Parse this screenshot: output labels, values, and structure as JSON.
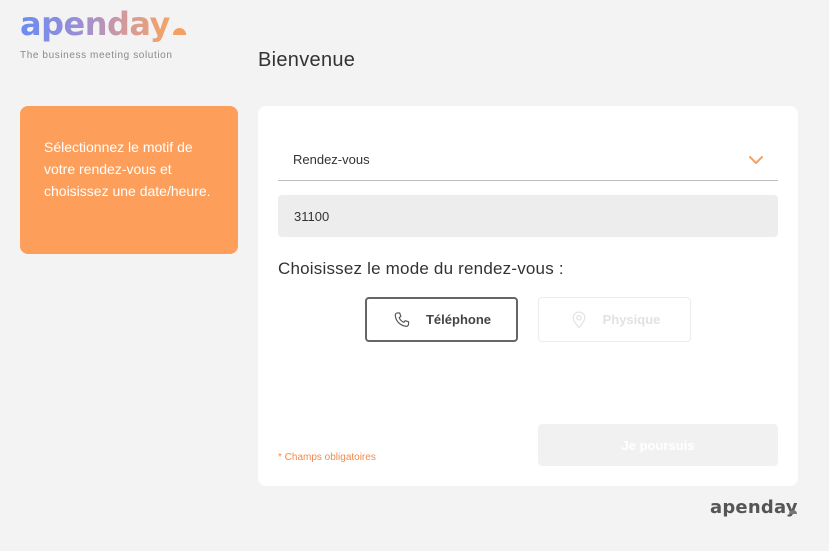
{
  "brand": {
    "logo_text": "apenday",
    "tagline": "The business meeting solution",
    "footer_logo_text": "apenday",
    "accent_color": "#fd9f5b"
  },
  "page": {
    "title": "Bienvenue"
  },
  "side_panel": {
    "text": "Sélectionnez le motif de votre rendez-vous et choisissez une date/heure."
  },
  "form": {
    "reason_select": {
      "value": "Rendez-vous",
      "icon": "chevron-down-icon"
    },
    "zip_input": {
      "value": "31100"
    },
    "mode_label": "Choisissez le mode du rendez-vous :",
    "modes": [
      {
        "label": "Téléphone",
        "icon": "phone-icon",
        "state": "selected"
      },
      {
        "label": "Physique",
        "icon": "location-pin-icon",
        "state": "disabled"
      }
    ],
    "required_note": "* Champs obligatoires",
    "continue_label": "Je poursuis"
  }
}
